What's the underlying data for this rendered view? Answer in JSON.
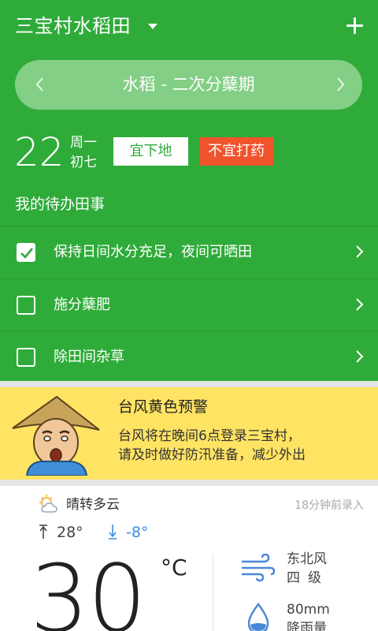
{
  "header": {
    "farm_name": "三宝村水稻田",
    "stage_title": "水稻 - 二次分蘖期"
  },
  "date": {
    "day": "22",
    "weekday": "周一",
    "lunar": "初七",
    "good_tag": "宜下地",
    "bad_tag": "不宜打药"
  },
  "todos": {
    "heading": "我的待办田事",
    "items": [
      {
        "text": "保持日间水分充足，夜间可晒田",
        "checked": true
      },
      {
        "text": "施分蘖肥",
        "checked": false
      },
      {
        "text": "除田间杂草",
        "checked": false
      }
    ]
  },
  "warning": {
    "title": "台风黄色预警",
    "line1": "台风将在晚间6点登录三宝村，",
    "line2": "请及时做好防汛准备，减少外出"
  },
  "weather": {
    "condition": "晴转多云",
    "updated": "18分钟前录入",
    "high": "28°",
    "low": "-8°",
    "current": "30",
    "unit": "°C",
    "wind_direction": "东北风",
    "wind_level": "四级",
    "rainfall": "80mm",
    "rainfall_label": "降雨量"
  },
  "colors": {
    "brand_green": "#2fab3a",
    "warning_yellow": "#ffe363",
    "bad_tag_red": "#f0542d",
    "cold_blue": "#3d8fe0"
  },
  "icons": [
    "dropdown-icon",
    "add-icon",
    "chevron-left-icon",
    "chevron-right-icon",
    "checkbox-icon",
    "partly-cloudy-icon",
    "arrow-up-icon",
    "arrow-down-icon",
    "wind-icon",
    "raindrop-icon"
  ]
}
